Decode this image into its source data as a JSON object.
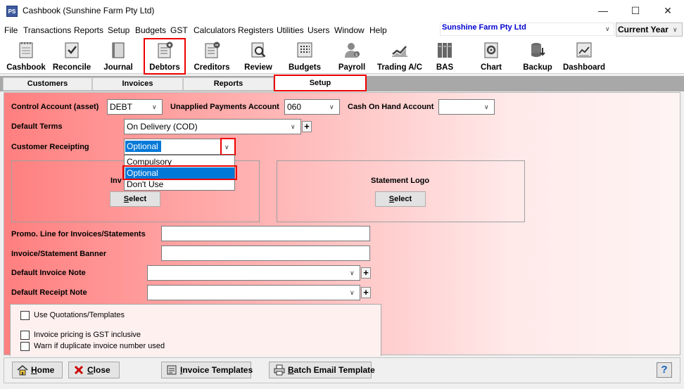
{
  "window": {
    "app_icon": "PS",
    "title": "Cashbook (Sunshine Farm Pty Ltd)",
    "minimize_icon": "—",
    "maximize_icon": "☐",
    "close_icon": "✕"
  },
  "menu": {
    "items": [
      "File",
      "Transactions",
      "Reports",
      "Setup",
      "Budgets",
      "GST",
      "Calculators",
      "Registers",
      "Utilities",
      "Users",
      "Window",
      "Help"
    ],
    "company": "Sunshine Farm Pty Ltd",
    "year": "Current Year"
  },
  "toolbar": {
    "items": [
      "Cashbook",
      "Reconcile",
      "Journal",
      "Debtors",
      "Creditors",
      "Review",
      "Budgets",
      "Payroll",
      "Trading A/C",
      "BAS",
      "Chart",
      "Backup",
      "Dashboard"
    ]
  },
  "tabs": [
    "Customers",
    "Invoices",
    "Reports",
    "Setup"
  ],
  "form": {
    "control_account_label": "Control Account (asset)",
    "control_account_value": "DEBT",
    "unapplied_label": "Unapplied Payments Account",
    "unapplied_value": "060",
    "cash_on_hand_label": "Cash On Hand Account",
    "cash_on_hand_value": "",
    "default_terms_label": "Default Terms",
    "default_terms_value": "On Delivery (COD)",
    "customer_receipting_label": "Customer Receipting",
    "customer_receipting_value": "Optional",
    "receipting_options": [
      "Compulsory",
      "Optional",
      "Don't Use"
    ],
    "invoice_logo_label_partial": "Inv",
    "statement_logo_label": "Statement Logo",
    "select_label": "elect",
    "select_key": "S",
    "promo_label": "Promo. Line for Invoices/Statements",
    "banner_label": "Invoice/Statement Banner",
    "invoice_note_label": "Default Invoice Note",
    "receipt_note_label": "Default Receipt Note",
    "use_quotations_label": "Use Quotations/Templates",
    "gst_inclusive_label": "Invoice pricing is GST inclusive",
    "warn_duplicate_label": "Warn if duplicate invoice number used"
  },
  "bottom": {
    "home_key": "H",
    "home_rest": "ome",
    "close_key": "C",
    "close_rest": "lose",
    "invoice_templates_key": "I",
    "invoice_templates_rest": "nvoice Templates",
    "batch_email_key": "B",
    "batch_email_rest": "atch Email Template",
    "help": "?"
  },
  "colors": {
    "highlight_red": "#ee0000",
    "selection_blue": "#0078d7",
    "company_blue": "#0000d0"
  }
}
